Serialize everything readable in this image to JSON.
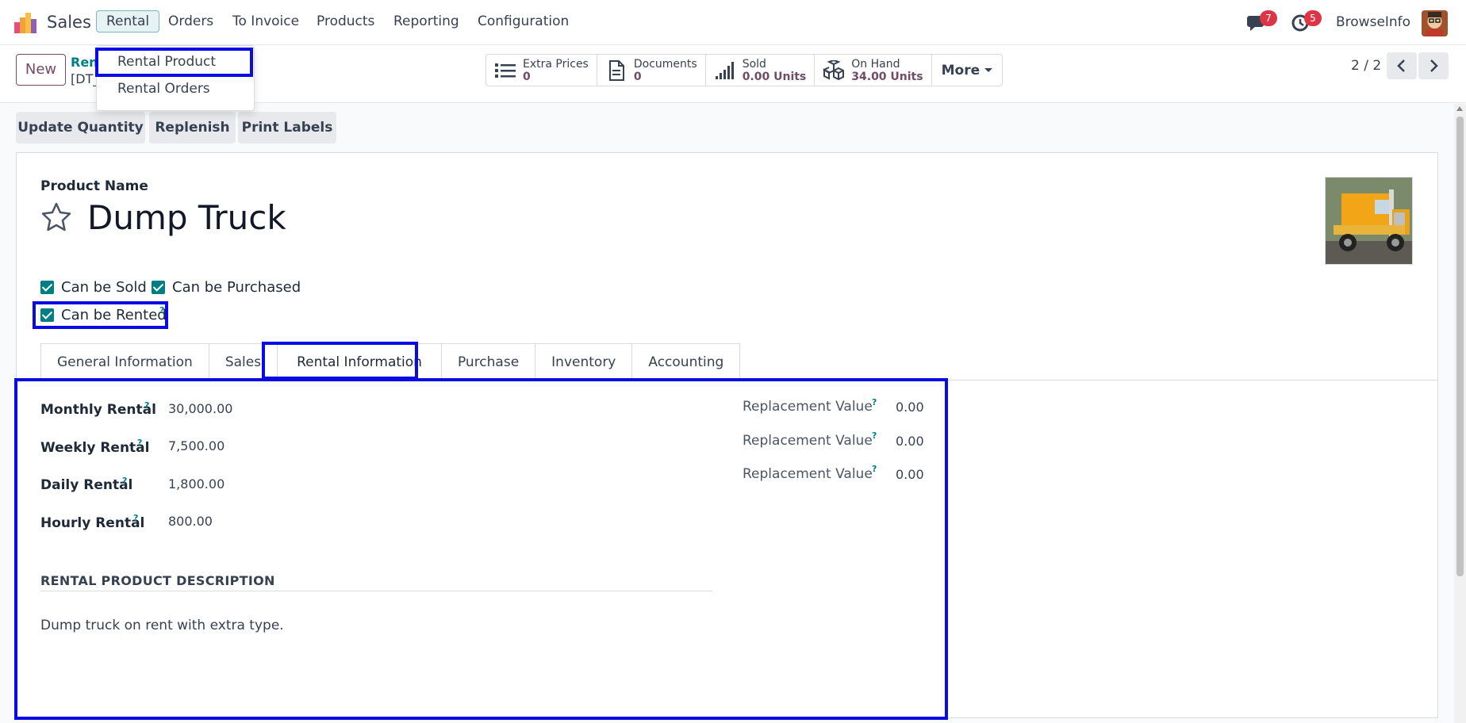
{
  "navbar": {
    "app_name": "Sales",
    "menus": [
      "Rental",
      "Orders",
      "To Invoice",
      "Products",
      "Reporting",
      "Configuration"
    ],
    "messages_count": "7",
    "activities_count": "5",
    "company": "BrowseInfo"
  },
  "dropdown": {
    "items": [
      "Rental Product",
      "Rental Orders"
    ]
  },
  "control": {
    "new_label": "New",
    "breadcrumb_parent": "Ren",
    "breadcrumb_code": "[DT_",
    "stats": [
      {
        "icon": "list-icon",
        "label": "Extra Prices",
        "value": "0"
      },
      {
        "icon": "document-icon",
        "label": "Documents",
        "value": "0"
      },
      {
        "icon": "signal-bars-icon",
        "label": "Sold",
        "value": "0.00 Units"
      },
      {
        "icon": "cubes-icon",
        "label": "On Hand",
        "value": "34.00 Units"
      }
    ],
    "more_label": "More",
    "pager": "2 / 2"
  },
  "actions": [
    "Update Quantity",
    "Replenish",
    "Print Labels"
  ],
  "form": {
    "product_name_label": "Product Name",
    "product_name": "Dump Truck",
    "checkboxes": [
      "Can be Sold",
      "Can be Purchased",
      "Can be Rented"
    ],
    "help_mark": "?",
    "tabs": [
      "General Information",
      "Sales",
      "Rental Information",
      "Purchase",
      "Inventory",
      "Accounting"
    ],
    "active_tab": "Rental Information",
    "rental_fields": [
      {
        "label": "Monthly Rental",
        "value": "30,000.00"
      },
      {
        "label": "Weekly Rental",
        "value": "7,500.00"
      },
      {
        "label": "Daily Rental",
        "value": "1,800.00"
      },
      {
        "label": "Hourly Rental",
        "value": "800.00"
      }
    ],
    "replacement_fields": [
      {
        "label": "Replacement Value",
        "value": "0.00"
      },
      {
        "label": "Replacement Value",
        "value": "0.00"
      },
      {
        "label": "Replacement Value",
        "value": "0.00"
      }
    ],
    "section_title": "RENTAL PRODUCT DESCRIPTION",
    "description": "Dump truck on rent with extra type."
  },
  "colors": {
    "brand": "#714b67",
    "accent": "#017e84",
    "highlight": "#0a0ae6",
    "badge": "#dc3545"
  }
}
